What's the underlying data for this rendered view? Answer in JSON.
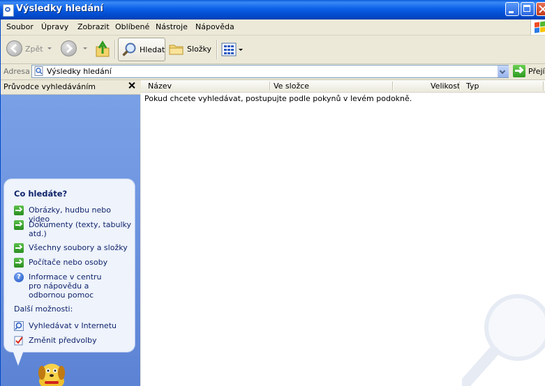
{
  "window": {
    "title": "Výsledky hledání"
  },
  "menu": [
    "Soubor",
    "Úpravy",
    "Zobrazit",
    "Oblíbené",
    "Nástroje",
    "Nápověda"
  ],
  "toolbar": {
    "back_label": "Zpět",
    "search_label": "Hledat",
    "folders_label": "Složky"
  },
  "address": {
    "label": "Adresa",
    "value": "Výsledky hledání",
    "go_label": "Přejít"
  },
  "search_pane": {
    "title": "Průvodce vyhledáváním",
    "heading": "Co hledáte?",
    "options": [
      {
        "label": "Obrázky, hudbu nebo video",
        "icon": "green-arrow-icon"
      },
      {
        "label": "Dokumenty (texty, tabulky atd.)",
        "icon": "green-arrow-icon"
      },
      {
        "label": "Všechny soubory a složky",
        "icon": "green-arrow-icon"
      },
      {
        "label": "Počítače nebo osoby",
        "icon": "green-arrow-icon"
      },
      {
        "label": "Informace v centru pro nápovědu a odbornou pomoc",
        "icon": "help-icon"
      }
    ],
    "more_label": "Další možnosti:",
    "more_options": [
      {
        "label": "Vyhledávat v Internetu",
        "icon": "web-search-icon"
      },
      {
        "label": "Změnit předvolby",
        "icon": "preferences-icon"
      }
    ]
  },
  "results": {
    "columns": [
      "Název",
      "Ve složce",
      "Velikost",
      "Typ"
    ],
    "message": "Pokud chcete vyhledávat, postupujte podle pokynů v levém podokně."
  },
  "colors": {
    "title_bar": "#0b5fe6",
    "left_pane": "#6d93df",
    "bubble_text": "#10246b"
  }
}
